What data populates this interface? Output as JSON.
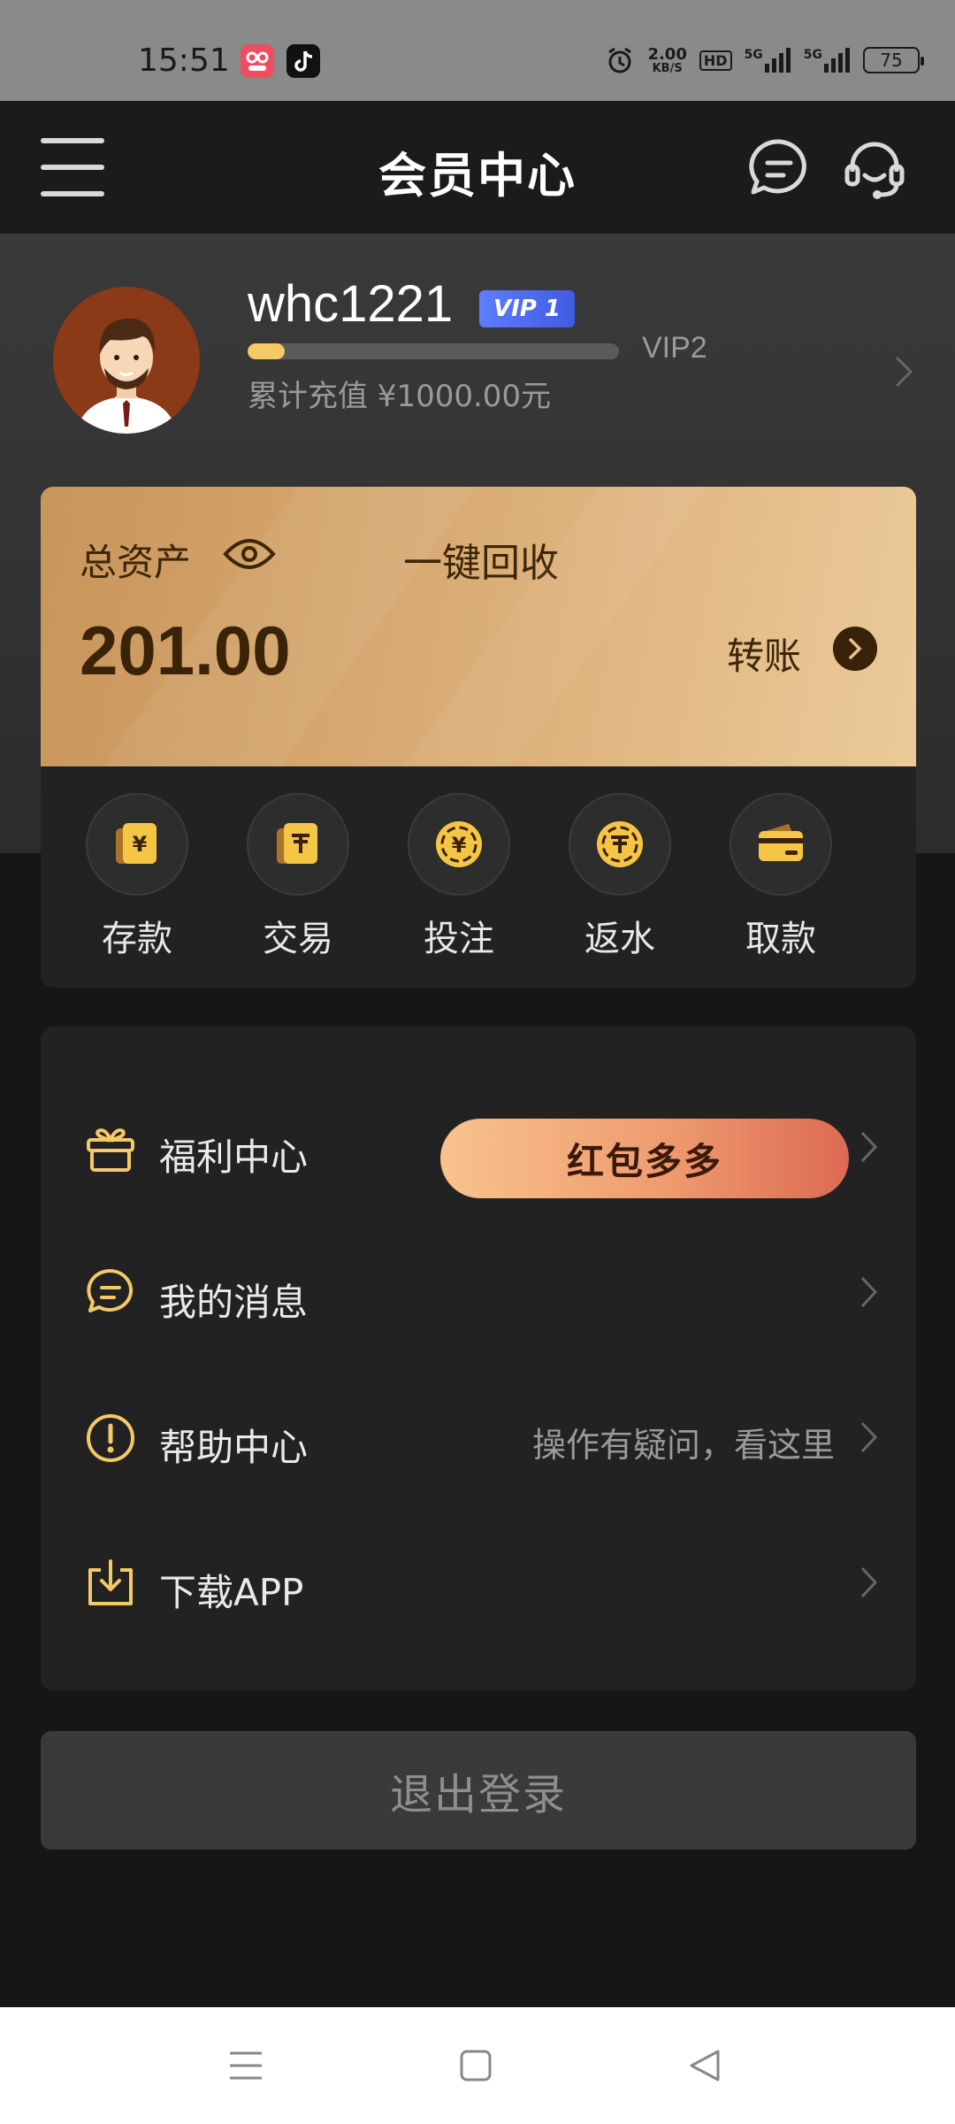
{
  "status_bar": {
    "time": "15:51",
    "net_speed_value": "2.00",
    "net_speed_unit": "KB/S",
    "hd_label": "HD",
    "signal1_label": "5G",
    "signal2_label": "5G",
    "battery": "75"
  },
  "header": {
    "title": "会员中心"
  },
  "profile": {
    "username": "whc1221",
    "vip_badge": "VIP 1",
    "next_level": "VIP2",
    "progress_fraction": 0.1,
    "recharge_text": "累计充值 ¥1000.00元"
  },
  "assets": {
    "label": "总资产",
    "recover_label": "一键回收",
    "value": "201.00",
    "transfer_label": "转账"
  },
  "actions": [
    {
      "label": "存款",
      "icon": "deposit-icon"
    },
    {
      "label": "交易",
      "icon": "trade-icon"
    },
    {
      "label": "投注",
      "icon": "bet-icon"
    },
    {
      "label": "返水",
      "icon": "rebate-icon"
    },
    {
      "label": "取款",
      "icon": "withdraw-icon"
    }
  ],
  "menu": {
    "welfare": {
      "label": "福利中心",
      "button": "红包多多"
    },
    "messages": {
      "label": "我的消息"
    },
    "help": {
      "label": "帮助中心",
      "hint": "操作有疑问，看这里"
    },
    "download": {
      "label": "下载APP"
    }
  },
  "logout_label": "退出登录",
  "colors": {
    "accent_gold": "#f4c966",
    "vip_blue": "#5f7dff",
    "background": "#161616"
  }
}
